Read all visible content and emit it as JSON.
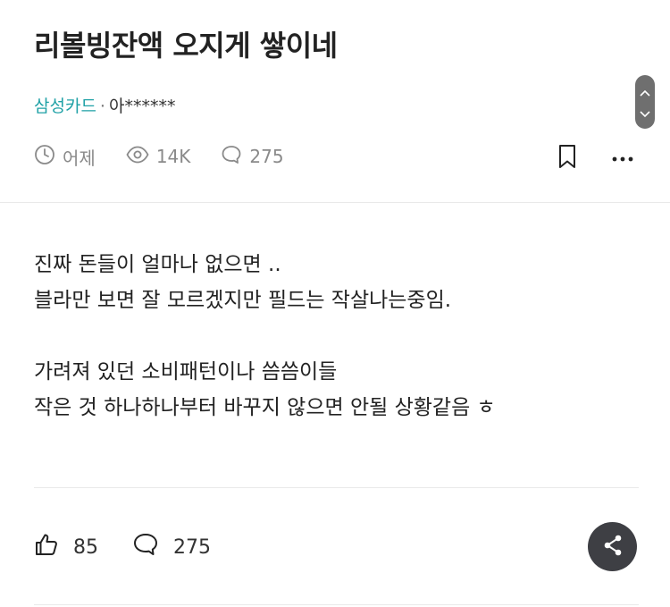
{
  "post": {
    "title": "리볼빙잔액 오지게 쌓이네",
    "company": "삼성카드",
    "separator": "·",
    "author": "아******"
  },
  "stats": {
    "time": "어제",
    "views": "14K",
    "comments": "275"
  },
  "body": {
    "lines": [
      "진짜 돈들이 얼마나 없으면 ..",
      "블라만 보면 잘 모르겠지만 필드는 작살나는중임.",
      "",
      "가려져 있던 소비패턴이나 씀씀이들",
      "작은 것 하나하나부터 바꾸지 않으면 안될 상황같음 ㅎ"
    ]
  },
  "footer": {
    "likes": "85",
    "comments": "275"
  },
  "icons": {
    "clock": "clock-icon",
    "eye": "eye-icon",
    "comment": "comment-icon",
    "bookmark": "bookmark-icon",
    "more": "more-icon",
    "thumb": "thumbs-up-icon",
    "share": "share-icon",
    "scroll_up": "chevron-up-icon",
    "scroll_down": "chevron-down-icon"
  },
  "colors": {
    "company": "#1fa1a6",
    "share_button": "#3e3f44",
    "stat_text": "#8a8a8a"
  }
}
